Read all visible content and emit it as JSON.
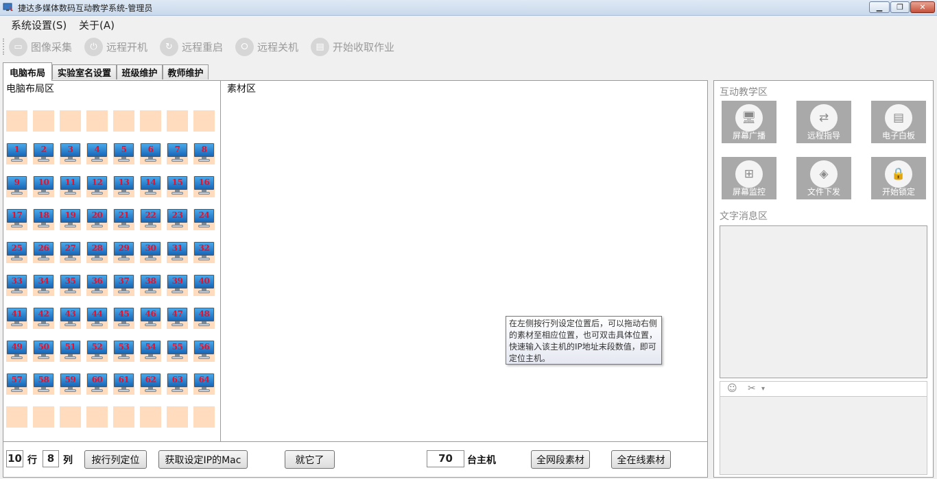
{
  "window": {
    "title": "捷达多媒体数码互动教学系统-管理员",
    "minimize_symbol": "▁",
    "maximize_symbol": "❐",
    "close_symbol": "✕"
  },
  "menu": [
    {
      "label": "系统设置(S)"
    },
    {
      "label": "关于(A)"
    }
  ],
  "toolbar": [
    {
      "label": "图像采集",
      "icon": "camera-icon",
      "glyph": "▭"
    },
    {
      "label": "远程开机",
      "icon": "power-on-icon",
      "glyph": "⏻"
    },
    {
      "label": "远程重启",
      "icon": "restart-icon",
      "glyph": "↻"
    },
    {
      "label": "远程关机",
      "icon": "shutdown-icon",
      "glyph": "⭘"
    },
    {
      "label": "开始收取作业",
      "icon": "homework-icon",
      "glyph": "▤"
    }
  ],
  "tabs": [
    {
      "label": "电脑布局",
      "active": true
    },
    {
      "label": "实验室名设置"
    },
    {
      "label": "班级维护"
    },
    {
      "label": "教师维护"
    }
  ],
  "layout_area": {
    "title": "电脑布局区",
    "rows": 10,
    "cols": 8,
    "assigned": [
      [
        null,
        null,
        null,
        null,
        null,
        null,
        null,
        null
      ],
      [
        "1",
        "2",
        "3",
        "4",
        "5",
        "6",
        "7",
        "8"
      ],
      [
        "9",
        "10",
        "11",
        "12",
        "13",
        "14",
        "15",
        "16"
      ],
      [
        "17",
        "18",
        "19",
        "20",
        "21",
        "22",
        "23",
        "24"
      ],
      [
        "25",
        "26",
        "27",
        "28",
        "29",
        "30",
        "31",
        "32"
      ],
      [
        "33",
        "34",
        "35",
        "36",
        "37",
        "38",
        "39",
        "40"
      ],
      [
        "41",
        "42",
        "43",
        "44",
        "45",
        "46",
        "47",
        "48"
      ],
      [
        "49",
        "50",
        "51",
        "52",
        "53",
        "54",
        "55",
        "56"
      ],
      [
        "57",
        "58",
        "59",
        "60",
        "61",
        "62",
        "63",
        "64"
      ],
      [
        null,
        null,
        null,
        null,
        null,
        null,
        null,
        null
      ]
    ],
    "cell_color": "#ffdcbd",
    "number_color": "#e8102a"
  },
  "material_area": {
    "title": "素材区",
    "tooltip": "在左侧按行列设定位置后，可以拖动右侧的素材至相应位置，也可双击具体位置，快速输入该主机的IP地址末段数值，即可定位主机。"
  },
  "bottom_bar": {
    "rows_value": "10",
    "rows_label": "行",
    "cols_value": "8",
    "cols_label": "列",
    "locate_button": "按行列定位",
    "get_mac_button": "获取设定IP的Mac",
    "confirm_button": "就它了",
    "host_count": "70",
    "host_label": "台主机",
    "all_segment_button": "全网段素材",
    "all_online_button": "全在线素材"
  },
  "right_panel": {
    "interactive_title": "互动教学区",
    "features": [
      {
        "label": "屏幕广播",
        "icon": "screen-broadcast-icon",
        "glyph": "🖥"
      },
      {
        "label": "远程指导",
        "icon": "remote-guide-icon",
        "glyph": "⇄"
      },
      {
        "label": "电子白板",
        "icon": "whiteboard-icon",
        "glyph": "▤"
      },
      {
        "label": "屏幕监控",
        "icon": "screen-monitor-icon",
        "glyph": "⊞"
      },
      {
        "label": "文件下发",
        "icon": "file-distribute-icon",
        "glyph": "◈"
      },
      {
        "label": "开始锁定",
        "icon": "lock-screen-icon",
        "glyph": "🔒"
      }
    ],
    "message_title": "文字消息区",
    "emoji_glyph": "☺",
    "scissors_glyph": "✂",
    "dropdown_glyph": "▾",
    "feature_bg": "#a9a9a9"
  }
}
